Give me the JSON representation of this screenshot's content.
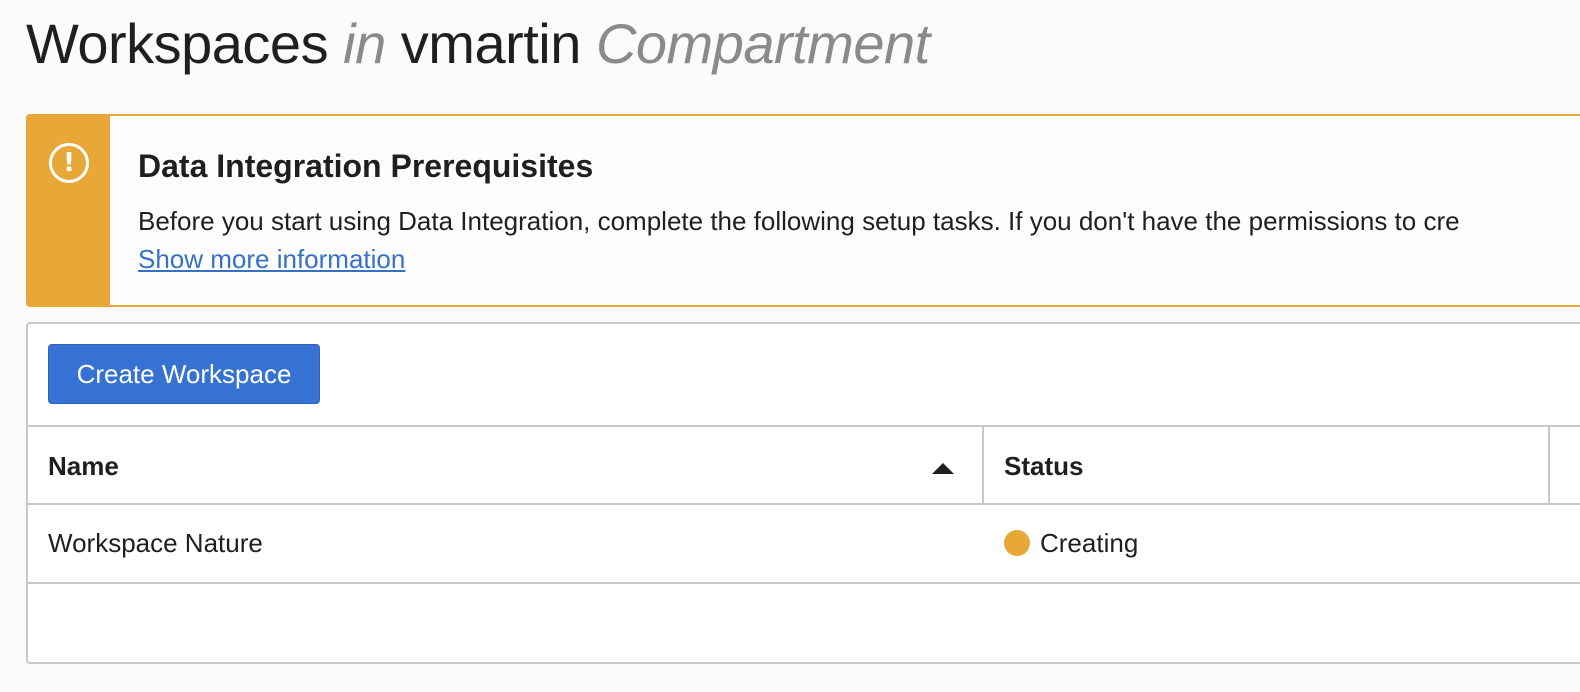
{
  "header": {
    "title_main": "Workspaces",
    "title_in": "in",
    "compartment_name": "vmartin",
    "compartment_word": "Compartment"
  },
  "alert": {
    "icon": "exclamation-icon",
    "title": "Data Integration Prerequisites",
    "body": "Before you start using Data Integration, complete the following setup tasks. If you don't have the permissions to cre",
    "link": "Show more information",
    "accent_color": "#e8a838"
  },
  "toolbar": {
    "create_label": "Create Workspace",
    "button_color": "#3572d4"
  },
  "table": {
    "columns": [
      {
        "label": "Name",
        "sort": "ascending"
      },
      {
        "label": "Status"
      }
    ],
    "rows": [
      {
        "name": "Workspace Nature",
        "status": "Creating",
        "status_color": "#e8a838"
      }
    ]
  }
}
